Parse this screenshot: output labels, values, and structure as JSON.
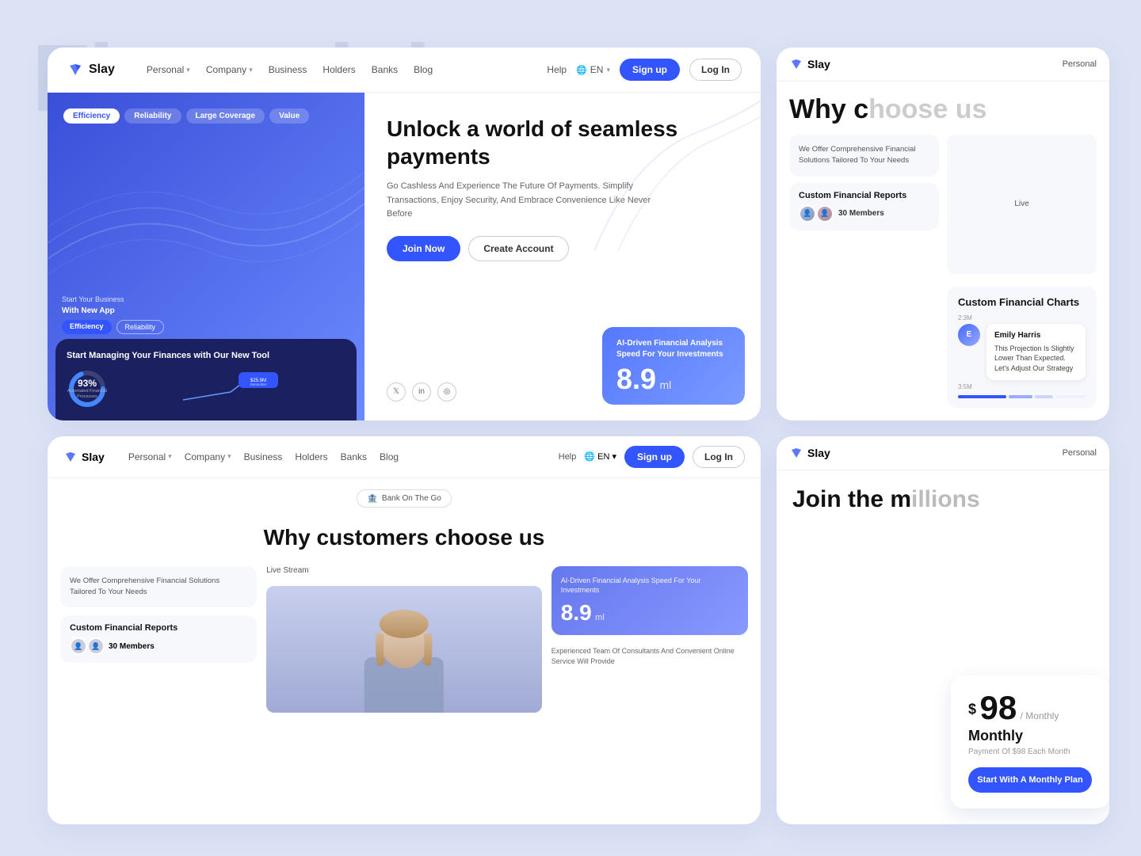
{
  "bg_text": "Financial",
  "card_hero": {
    "navbar": {
      "logo": "Slay",
      "nav_items": [
        {
          "label": "Personal",
          "has_dropdown": true
        },
        {
          "label": "Company",
          "has_dropdown": true
        },
        {
          "label": "Business"
        },
        {
          "label": "Holders"
        },
        {
          "label": "Banks"
        },
        {
          "label": "Blog"
        }
      ],
      "help": "Help",
      "lang": "EN",
      "btn_signup": "Sign up",
      "btn_login": "Log In"
    },
    "hero_tags": [
      {
        "label": "Efficiency",
        "active": true
      },
      {
        "label": "Reliability",
        "active": false
      },
      {
        "label": "Large Coverage",
        "active": false
      },
      {
        "label": "Value",
        "active": false
      }
    ],
    "app_label1": "Start Your Business",
    "app_label2": "With New App",
    "mockup_tag1": "Efficiency",
    "mockup_tag2": "Reliability",
    "phone_title": "Start Managing Your Finances with Our New Tool",
    "donut_pct": "93%",
    "donut_sub": "Automated Financial Processes",
    "chart_point": "$25.9M",
    "chart_month": "December",
    "hero_heading": "Unlock a world of seamless payments",
    "hero_desc": "Go Cashless And Experience The Future Of Payments. Simplify Transactions, Enjoy Security, And Embrace Convenience Like Never Before",
    "btn_join": "Join Now",
    "btn_create": "Create Account",
    "ai_card_title": "AI-Driven Financial Analysis Speed For Your Investments",
    "ai_number": "8.9",
    "ai_unit": "ml",
    "social_x": "𝕏",
    "social_li": "in",
    "social_ig": "◎"
  },
  "card_right_top": {
    "logo": "Slay",
    "nav_label": "Personal",
    "why_heading": "Why c",
    "subcard1": {
      "title": "Custom Financial Reports",
      "desc": "We Offer Comprehensive Financial Solutions Tailored To Your Needs",
      "members": "30 Members"
    },
    "live_label": "Live",
    "subcard2": {
      "title": "Custom Financial Charts",
      "time1": "2:3M",
      "time2": "3:5M",
      "emily_name": "Emily Harris",
      "emily_msg": "This Projection Is Slightly Lower Than Expected. Let's Adjust Our Strategy"
    }
  },
  "card_bottom_left": {
    "navbar": {
      "logo": "Slay",
      "btn_signup": "Sign up",
      "btn_login": "Log In"
    },
    "bank_badge": "Bank On The Go",
    "why_heading": "Why customers choose us",
    "comprehensive": {
      "text": "We Offer Comprehensive Financial Solutions Tailored To Your Needs"
    },
    "custom_reports": {
      "title": "Custom Financial Reports",
      "members": "30 Members"
    },
    "live_stream": "Live Stream",
    "ai_card": {
      "title": "AI-Driven Financial Analysis Speed For Your Investments",
      "number": "8.9",
      "unit": "ml"
    },
    "experienced_text": "Experienced Team Of Consultants And Convenient Online Service Will Provide"
  },
  "card_right_bottom": {
    "logo": "Slay",
    "nav_label": "Personal",
    "join_heading": "Join the m",
    "pricing": {
      "amount": "98",
      "period": "/ Monthly",
      "label": "Monthly",
      "desc": "Payment Of $98 Each Month",
      "btn": "Start With A Monthly Plan"
    }
  }
}
